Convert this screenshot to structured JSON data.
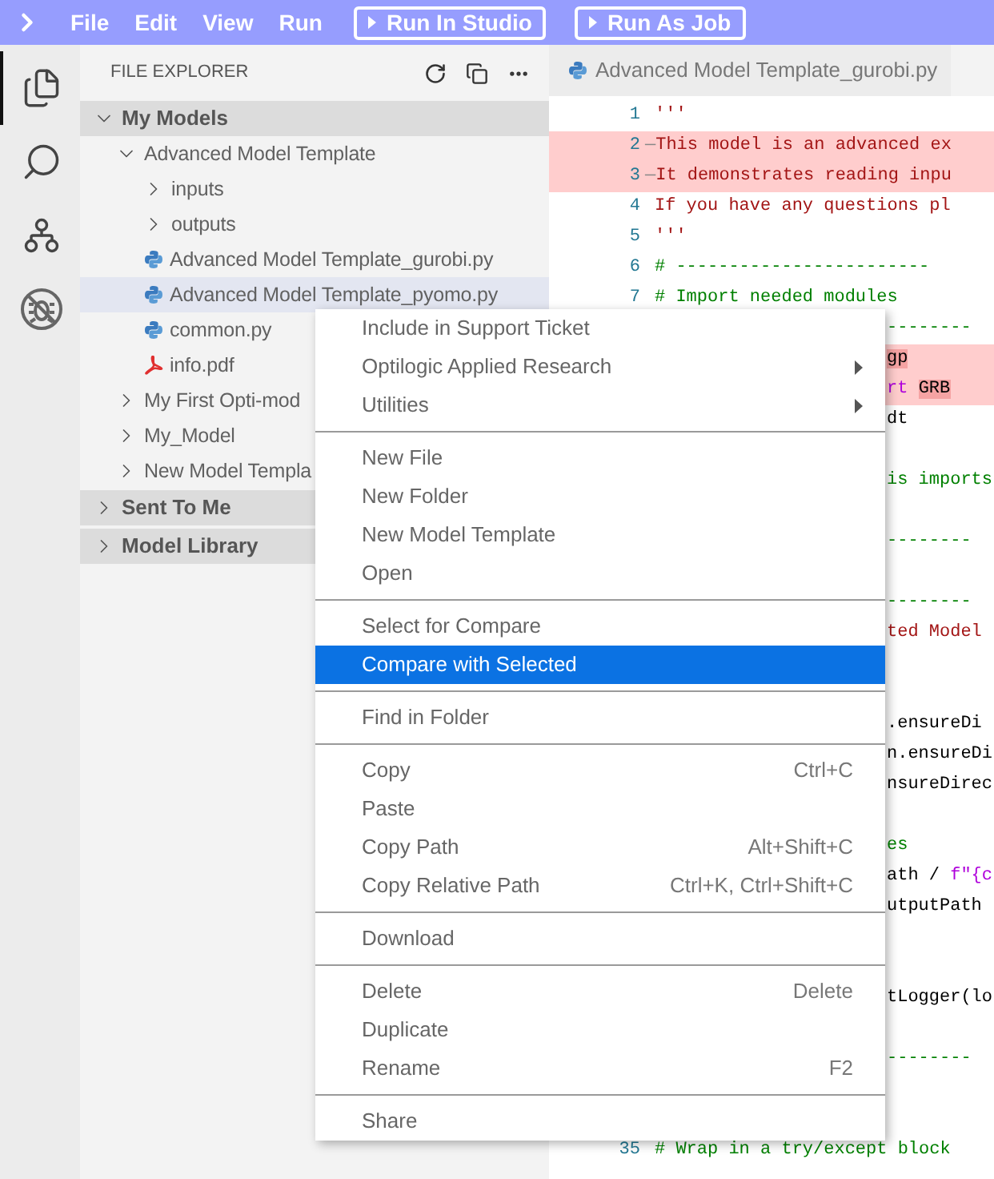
{
  "menu_bar": {
    "items": [
      "File",
      "Edit",
      "View",
      "Run"
    ],
    "buttons": [
      "Run In Studio",
      "Run As Job"
    ]
  },
  "activity_bar": [
    {
      "kind": "files",
      "selected": true
    },
    {
      "kind": "search",
      "selected": false
    },
    {
      "kind": "source-control",
      "selected": false
    },
    {
      "kind": "debug",
      "selected": false
    }
  ],
  "explorer": {
    "title": "FILE EXPLORER",
    "sections": [
      {
        "label": "Sent To Me",
        "expanded": false
      },
      {
        "label": "Model Library",
        "expanded": false
      }
    ],
    "main_section": {
      "label": "My Models",
      "expanded": true,
      "children": [
        {
          "label": "Advanced Model Template",
          "kind": "folder",
          "expanded": true,
          "selected": false,
          "children": [
            {
              "label": "inputs",
              "kind": "folder",
              "expanded": false,
              "selected": false
            },
            {
              "label": "outputs",
              "kind": "folder",
              "expanded": false,
              "selected": false
            },
            {
              "label": "Advanced Model Template_gurobi.py",
              "kind": "python",
              "selected": false
            },
            {
              "label": "Advanced Model Template_pyomo.py",
              "kind": "python",
              "selected": true
            },
            {
              "label": "common.py",
              "kind": "python",
              "selected": false
            },
            {
              "label": "info.pdf",
              "kind": "pdf",
              "selected": false
            }
          ]
        },
        {
          "label": "My First Opti-mod",
          "kind": "folder",
          "expanded": false,
          "selected": false
        },
        {
          "label": "My_Model",
          "kind": "folder",
          "expanded": false,
          "selected": false
        },
        {
          "label": "New Model Templa",
          "kind": "folder",
          "expanded": false,
          "selected": false
        }
      ]
    }
  },
  "editor": {
    "tab": {
      "label": "Advanced Model Template_gurobi.py"
    },
    "code_lines": [
      {
        "kind": "full",
        "number": "1",
        "highlighted": false,
        "segments": [
          {
            "text": "'''",
            "kind": "string"
          }
        ]
      },
      {
        "kind": "full",
        "number": "2",
        "highlighted": true,
        "segments": [
          {
            "text": "—",
            "kind": "marker"
          },
          {
            "text": "This model is an advanced ex",
            "kind": "string"
          }
        ]
      },
      {
        "kind": "full",
        "number": "3",
        "highlighted": true,
        "segments": [
          {
            "text": "—",
            "kind": "marker"
          },
          {
            "text": "It demonstrates reading inpu",
            "kind": "string"
          }
        ]
      },
      {
        "kind": "full",
        "number": "4",
        "highlighted": false,
        "segments": [
          {
            "text": "If you have any questions pl",
            "kind": "string"
          }
        ]
      },
      {
        "kind": "full",
        "number": "5",
        "highlighted": false,
        "segments": [
          {
            "text": "'''",
            "kind": "string"
          }
        ]
      },
      {
        "kind": "full",
        "number": "6",
        "highlighted": false,
        "segments": [
          {
            "text": "# ------------------------",
            "kind": "comment"
          }
        ]
      },
      {
        "kind": "full",
        "number": "7",
        "highlighted": false,
        "segments": [
          {
            "text": "# Import needed modules",
            "kind": "comment"
          }
        ]
      },
      {
        "kind": "partial",
        "highlighted": false,
        "segments": [
          {
            "text": "--------",
            "kind": "comment"
          }
        ]
      },
      {
        "kind": "partial",
        "highlighted": true,
        "segments": [
          {
            "text": "gp",
            "kind": "code",
            "emphasized": true
          }
        ]
      },
      {
        "kind": "partial",
        "highlighted": true,
        "segments": [
          {
            "text": "rt ",
            "kind": "keyword"
          },
          {
            "text": "GRB",
            "kind": "code",
            "emphasized": true
          }
        ]
      },
      {
        "kind": "partial",
        "highlighted": false,
        "segments": [
          {
            "text": "dt",
            "kind": "code"
          }
        ]
      },
      {
        "kind": "blank"
      },
      {
        "kind": "partial",
        "highlighted": false,
        "segments": [
          {
            "text": "is imports",
            "kind": "comment"
          }
        ]
      },
      {
        "kind": "blank"
      },
      {
        "kind": "partial",
        "highlighted": false,
        "segments": [
          {
            "text": "--------",
            "kind": "comment"
          }
        ]
      },
      {
        "kind": "blank"
      },
      {
        "kind": "partial",
        "highlighted": false,
        "segments": [
          {
            "text": "--------",
            "kind": "comment"
          }
        ]
      },
      {
        "kind": "partial",
        "highlighted": false,
        "segments": [
          {
            "text": "ted Model",
            "kind": "string"
          }
        ]
      },
      {
        "kind": "blank"
      },
      {
        "kind": "blank"
      },
      {
        "kind": "partial",
        "highlighted": false,
        "segments": [
          {
            "text": ".ensureDi",
            "kind": "code"
          }
        ]
      },
      {
        "kind": "partial",
        "highlighted": false,
        "segments": [
          {
            "text": "n.ensureDi",
            "kind": "code"
          }
        ]
      },
      {
        "kind": "partial",
        "highlighted": false,
        "segments": [
          {
            "text": "nsureDirec",
            "kind": "code"
          }
        ]
      },
      {
        "kind": "blank"
      },
      {
        "kind": "partial",
        "highlighted": false,
        "segments": [
          {
            "text": "es",
            "kind": "comment"
          }
        ]
      },
      {
        "kind": "partial",
        "highlighted": false,
        "segments": [
          {
            "text": "ath / ",
            "kind": "code"
          },
          {
            "text": "f\"{c",
            "kind": "keyword"
          }
        ]
      },
      {
        "kind": "partial",
        "highlighted": false,
        "segments": [
          {
            "text": "utputPath",
            "kind": "code"
          }
        ]
      },
      {
        "kind": "blank"
      },
      {
        "kind": "blank"
      },
      {
        "kind": "partial",
        "highlighted": false,
        "segments": [
          {
            "text": "tLogger(lo",
            "kind": "code"
          }
        ]
      },
      {
        "kind": "blank"
      },
      {
        "kind": "partial",
        "highlighted": false,
        "segments": [
          {
            "text": "--------",
            "kind": "comment"
          }
        ]
      },
      {
        "kind": "blank"
      },
      {
        "kind": "blank"
      },
      {
        "kind": "full",
        "number": "35",
        "highlighted": false,
        "segments": [
          {
            "text": "# Wrap in a try/except block",
            "kind": "comment"
          }
        ]
      }
    ]
  },
  "context_menu": {
    "groups": [
      [
        {
          "label": "Include in Support Ticket",
          "submenu": false,
          "selected": false
        },
        {
          "label": "Optilogic Applied Research",
          "submenu": true,
          "selected": false
        },
        {
          "label": "Utilities",
          "submenu": true,
          "selected": false
        }
      ],
      [
        {
          "label": "New File",
          "submenu": false,
          "selected": false
        },
        {
          "label": "New Folder",
          "submenu": false,
          "selected": false
        },
        {
          "label": "New Model Template",
          "submenu": false,
          "selected": false
        },
        {
          "label": "Open",
          "submenu": false,
          "selected": false
        }
      ],
      [
        {
          "label": "Select for Compare",
          "submenu": false,
          "selected": false
        },
        {
          "label": "Compare with Selected",
          "submenu": false,
          "selected": true
        }
      ],
      [
        {
          "label": "Find in Folder",
          "submenu": false,
          "selected": false
        }
      ],
      [
        {
          "label": "Copy",
          "shortcut": "Ctrl+C",
          "submenu": false,
          "selected": false
        },
        {
          "label": "Paste",
          "submenu": false,
          "selected": false
        },
        {
          "label": "Copy Path",
          "shortcut": "Alt+Shift+C",
          "submenu": false,
          "selected": false
        },
        {
          "label": "Copy Relative Path",
          "shortcut": "Ctrl+K, Ctrl+Shift+C",
          "submenu": false,
          "selected": false
        }
      ],
      [
        {
          "label": "Download",
          "submenu": false,
          "selected": false
        }
      ],
      [
        {
          "label": "Delete",
          "shortcut": "Delete",
          "submenu": false,
          "selected": false
        },
        {
          "label": "Duplicate",
          "submenu": false,
          "selected": false
        },
        {
          "label": "Rename",
          "shortcut": "F2",
          "submenu": false,
          "selected": false
        }
      ],
      [
        {
          "label": "Share",
          "submenu": false,
          "selected": false
        }
      ]
    ]
  }
}
